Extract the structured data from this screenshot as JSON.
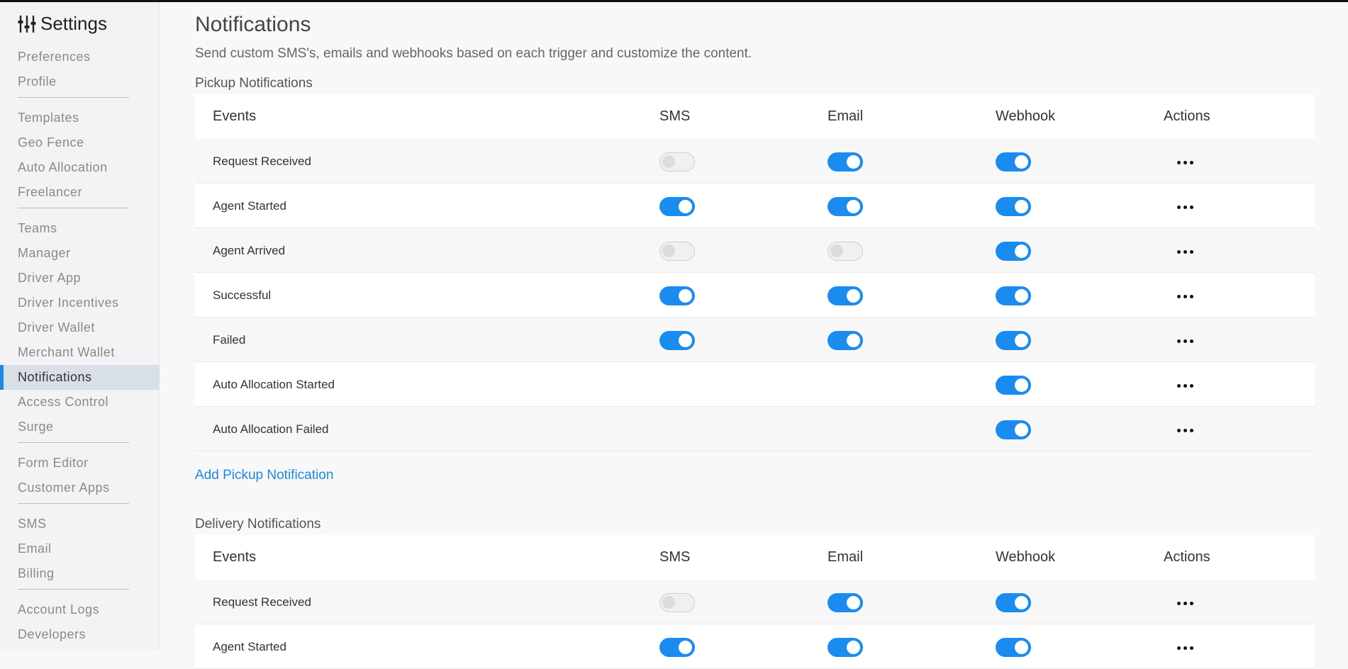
{
  "sidebar": {
    "title": "Settings",
    "title_icon": "sliders-icon",
    "groups": [
      [
        "Preferences",
        "Profile"
      ],
      [
        "Templates",
        "Geo Fence",
        "Auto Allocation",
        "Freelancer"
      ],
      [
        "Teams",
        "Manager",
        "Driver App",
        "Driver Incentives",
        "Driver Wallet",
        "Merchant Wallet",
        "Notifications",
        "Access Control",
        "Surge"
      ],
      [
        "Form Editor",
        "Customer Apps"
      ],
      [
        "SMS",
        "Email",
        "Billing"
      ],
      [
        "Account Logs",
        "Developers"
      ]
    ],
    "active": "Notifications",
    "accent_color": "#1e88e5"
  },
  "page": {
    "title": "Notifications",
    "subtitle": "Send custom SMS's, emails and webhooks based on each trigger and customize the content."
  },
  "columns": [
    "Events",
    "SMS",
    "Email",
    "Webhook",
    "Actions"
  ],
  "pickup": {
    "title": "Pickup Notifications",
    "add_label": "Add Pickup Notification",
    "rows": [
      {
        "event": "Request Received",
        "sms": false,
        "email": true,
        "webhook": true
      },
      {
        "event": "Agent Started",
        "sms": true,
        "email": true,
        "webhook": true
      },
      {
        "event": "Agent Arrived",
        "sms": false,
        "email": false,
        "webhook": true
      },
      {
        "event": "Successful",
        "sms": true,
        "email": true,
        "webhook": true
      },
      {
        "event": "Failed",
        "sms": true,
        "email": true,
        "webhook": true
      },
      {
        "event": "Auto Allocation Started",
        "sms": null,
        "email": null,
        "webhook": true
      },
      {
        "event": "Auto Allocation Failed",
        "sms": null,
        "email": null,
        "webhook": true
      }
    ]
  },
  "delivery": {
    "title": "Delivery Notifications",
    "rows": [
      {
        "event": "Request Received",
        "sms": false,
        "email": true,
        "webhook": true
      },
      {
        "event": "Agent Started",
        "sms": true,
        "email": true,
        "webhook": true
      }
    ]
  },
  "colors": {
    "toggle_on": "#1a8cf0",
    "link": "#1e88e5"
  }
}
